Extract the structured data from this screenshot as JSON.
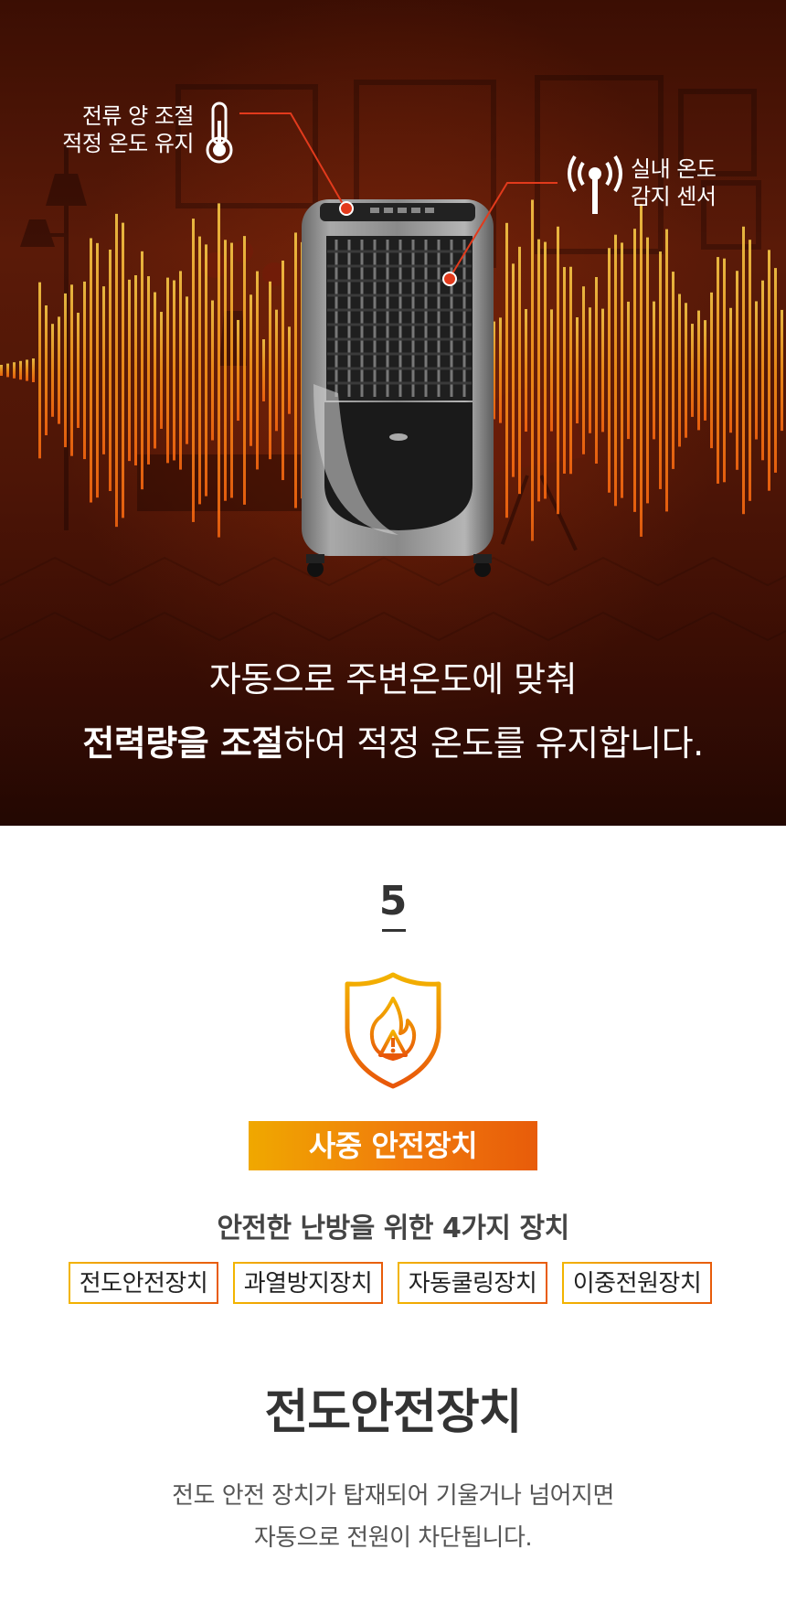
{
  "hero": {
    "callout_left": {
      "line1": "전류 양 조절",
      "line2": "적정 온도 유지",
      "icon": "thermometer-icon"
    },
    "callout_right": {
      "line1": "실내 온도",
      "line2": "감지 센서",
      "icon": "wireless-sensor-icon"
    },
    "line1": "자동으로 주변온도에 맞춰",
    "line2_bold": "전력량을 조절",
    "line2_rest": "하여 적정 온도를 유지합니다."
  },
  "section": {
    "number": "5",
    "icon": "fire-shield-warning-icon",
    "badge": "사중 안전장치",
    "subtitle": "안전한 난방을 위한 4가지 장치",
    "devices": [
      "전도안전장치",
      "과열방지장치",
      "자동쿨링장치",
      "이중전원장치"
    ],
    "title": "전도안전장치",
    "desc_line1": "전도 안전 장치가 탑재되어 기울거나 넘어지면",
    "desc_line2": "자동으로 전원이 차단됩니다."
  },
  "colors": {
    "accent_start": "#f2b400",
    "accent_end": "#e85c0a",
    "callout_dot": "#e23a1c"
  }
}
